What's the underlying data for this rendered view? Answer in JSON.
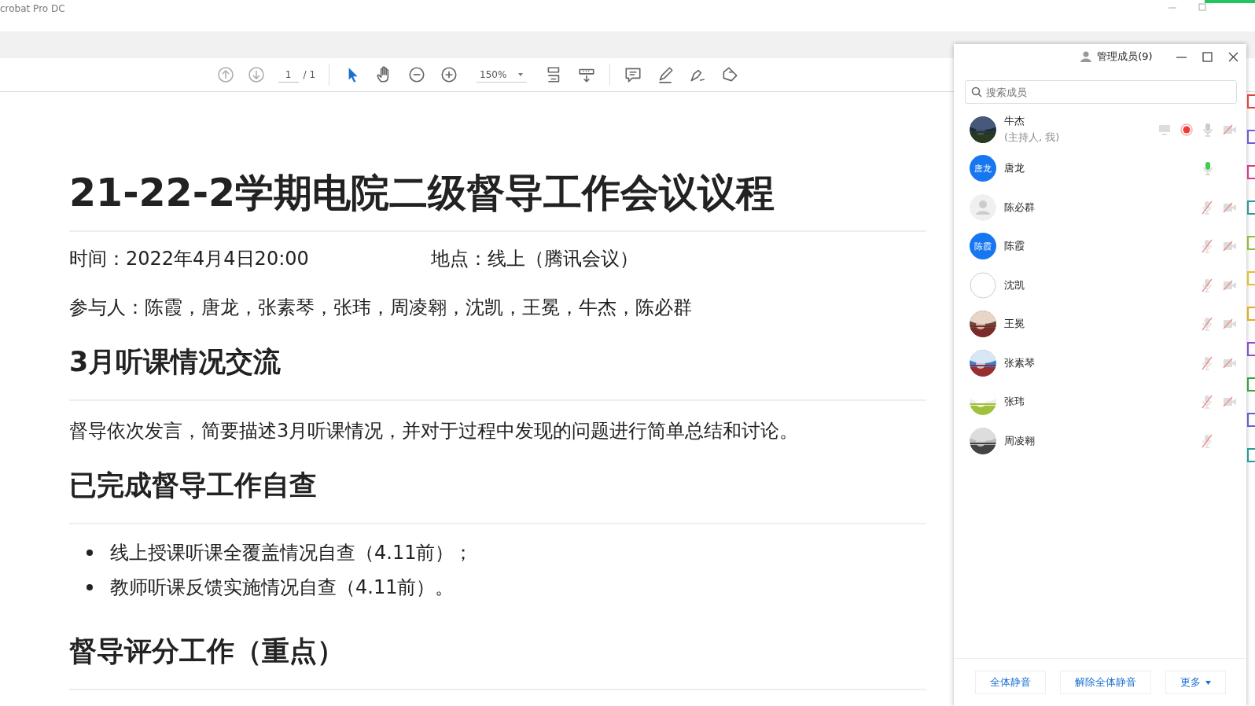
{
  "window": {
    "title": "crobat Pro DC"
  },
  "toolbar": {
    "page": "1",
    "page_total": "/ 1",
    "zoom": "150%",
    "tools": [
      {
        "kind": "prev-page",
        "selected": false
      },
      {
        "kind": "next-page",
        "selected": false
      },
      {
        "kind": "page-field",
        "selected": false
      },
      {
        "kind": "select",
        "selected": true
      },
      {
        "kind": "hand",
        "selected": false
      },
      {
        "kind": "zoom-out",
        "selected": false
      },
      {
        "kind": "zoom-in",
        "selected": false
      },
      {
        "kind": "zoom-field",
        "selected": false
      },
      {
        "kind": "fit",
        "selected": false
      },
      {
        "kind": "scroll",
        "selected": false
      },
      {
        "kind": "comment",
        "selected": false
      },
      {
        "kind": "highlight",
        "selected": false
      },
      {
        "kind": "sign",
        "selected": false
      },
      {
        "kind": "stamp",
        "selected": false
      }
    ]
  },
  "document": {
    "blocks": [
      {
        "kind": "title",
        "text": "21-22-2学期电院二级督导工作会议议程"
      },
      {
        "kind": "info",
        "items": [
          "时间：2022年4月4日20:00",
          "地点：线上（腾讯会议）"
        ]
      },
      {
        "kind": "para",
        "text": "参与人：陈霞，唐龙，张素琴，张玮，周凌翱，沈凯，王冕，牛杰，陈必群"
      },
      {
        "kind": "heading",
        "text": "3月听课情况交流"
      },
      {
        "kind": "para",
        "text": "督导依次发言，简要描述3月听课情况，并对于过程中发现的问题进行简单总结和讨论。"
      },
      {
        "kind": "heading",
        "text": "已完成督导工作自查"
      },
      {
        "kind": "bullets",
        "items": [
          "线上授课听课全覆盖情况自查（4.11前）；",
          "教师听课反馈实施情况自查（4.11前）。"
        ]
      },
      {
        "kind": "heading",
        "text": "督导评分工作（重点）"
      }
    ]
  },
  "panel": {
    "title": "管理成员(9)",
    "search": {
      "placeholder": "搜索成员"
    },
    "members": [
      {
        "name": "牛杰",
        "note": "(主持人, 我)",
        "host": true,
        "mic": {
          "kind": "idle"
        },
        "camera_off": true
      },
      {
        "name": "唐龙",
        "avatar": {
          "kind": "initials",
          "text": "唐龙"
        },
        "host": false,
        "mic": {
          "kind": "active"
        },
        "camera_off": false
      },
      {
        "name": "陈必群",
        "avatar": {
          "kind": "default"
        },
        "host": false,
        "mic": {
          "kind": "muted"
        },
        "camera_off": true
      },
      {
        "name": "陈霞",
        "avatar": {
          "kind": "initials",
          "text": "陈霞"
        },
        "host": false,
        "mic": {
          "kind": "muted"
        },
        "camera_off": true
      },
      {
        "name": "沈凯",
        "avatar": {
          "kind": "blank"
        },
        "host": false,
        "mic": {
          "kind": "muted"
        },
        "camera_off": true
      },
      {
        "name": "王冕",
        "host": false,
        "mic": {
          "kind": "muted"
        },
        "camera_off": true
      },
      {
        "name": "张素琴",
        "host": false,
        "mic": {
          "kind": "muted"
        },
        "camera_off": true
      },
      {
        "name": "张玮",
        "host": false,
        "mic": {
          "kind": "muted"
        },
        "camera_off": true
      },
      {
        "name": "周凌翱",
        "host": false,
        "mic": {
          "kind": "muted"
        },
        "camera_off": false
      }
    ],
    "buttons": [
      "全体静音",
      "解除全体静音",
      "更多"
    ]
  }
}
